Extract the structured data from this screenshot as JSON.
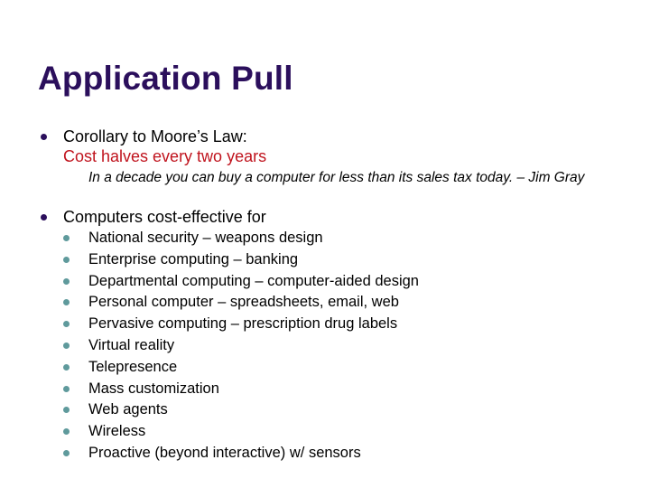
{
  "slide": {
    "title": "Application Pull",
    "colors": {
      "title": "#2b0f5c",
      "highlight": "#c0141e",
      "level1_bullet": "#2b0f5c",
      "level2_bullet": "#5f9a9c"
    },
    "bullets": [
      {
        "text": "Corollary to Moore’s Law:",
        "highlight": "Cost halves every two years",
        "quote": "In a decade you can buy a computer for less than its sales tax today. – Jim Gray"
      },
      {
        "text": "Computers cost-effective for",
        "subitems": [
          "National security – weapons design",
          "Enterprise computing – banking",
          "Departmental computing – computer-aided design",
          "Personal computer – spreadsheets, email, web",
          "Pervasive computing – prescription drug labels",
          "Virtual reality",
          "Telepresence",
          "Mass customization",
          "Web agents",
          "Wireless",
          "Proactive (beyond interactive) w/ sensors"
        ]
      }
    ]
  }
}
